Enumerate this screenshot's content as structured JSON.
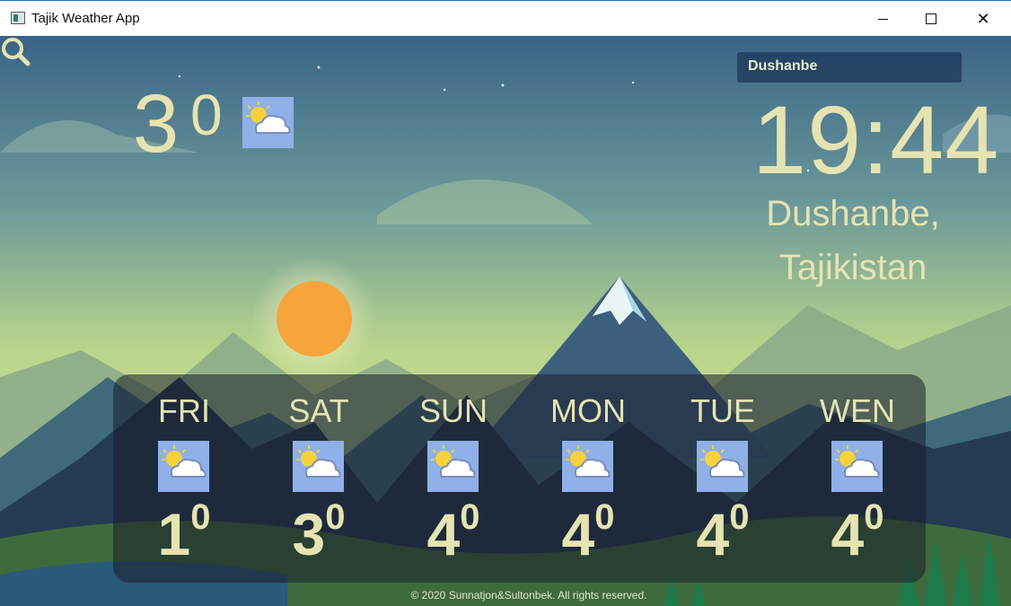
{
  "window": {
    "title": "Tajik Weather App"
  },
  "search": {
    "value": "Dushanbe"
  },
  "current": {
    "temperature": "3",
    "degree": "0",
    "icon": "partly-cloudy-icon"
  },
  "clock": {
    "time": "19:44"
  },
  "location": {
    "city": "Dushanbe,",
    "country": "Tajikistan"
  },
  "forecast": [
    {
      "day": "FRI",
      "temp": "1",
      "deg": "0",
      "icon": "partly-cloudy-icon"
    },
    {
      "day": "SAT",
      "temp": "3",
      "deg": "0",
      "icon": "partly-cloudy-icon"
    },
    {
      "day": "SUN",
      "temp": "4",
      "deg": "0",
      "icon": "partly-cloudy-icon"
    },
    {
      "day": "MON",
      "temp": "4",
      "deg": "0",
      "icon": "partly-cloudy-icon"
    },
    {
      "day": "TUE",
      "temp": "4",
      "deg": "0",
      "icon": "partly-cloudy-icon"
    },
    {
      "day": "WEN",
      "temp": "4",
      "deg": "0",
      "icon": "partly-cloudy-icon"
    }
  ],
  "footer": {
    "text": "© 2020 Sunnatjon&Sultonbek. All rights reserved."
  },
  "colors": {
    "text": "#e6e3b2",
    "accent": "#1f6fb5"
  }
}
